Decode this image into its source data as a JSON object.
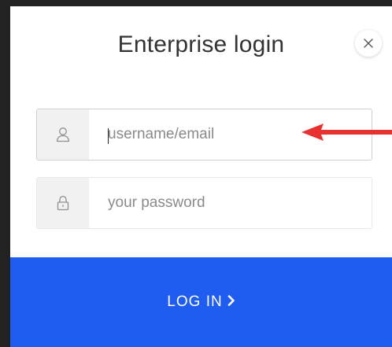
{
  "modal": {
    "title": "Enterprise login",
    "close_icon": "close-icon"
  },
  "form": {
    "username": {
      "icon": "user-icon",
      "placeholder": "username/email",
      "value": ""
    },
    "password": {
      "icon": "lock-icon",
      "placeholder": "your password",
      "value": ""
    },
    "submit_label": "LOG IN",
    "submit_icon": "chevron-right-icon"
  },
  "annotation": {
    "icon": "red-arrow-left-icon",
    "color": "#e8322f"
  },
  "colors": {
    "accent": "#1f5cf0",
    "icon_box_bg": "#f1f1f1",
    "title_text": "#333333"
  }
}
